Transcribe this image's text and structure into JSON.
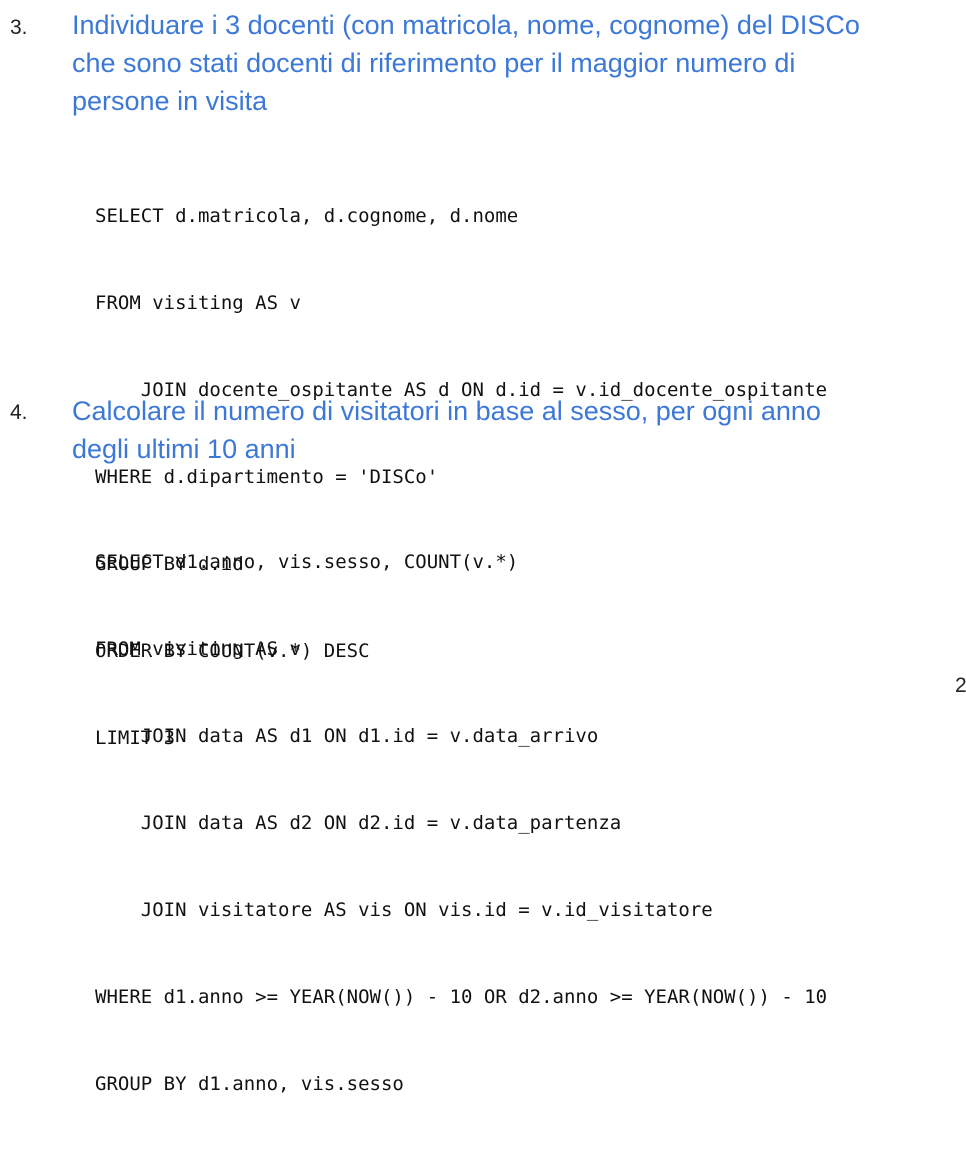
{
  "questions": [
    {
      "number": "3.",
      "title_lines": [
        "Individuare i 3 docenti (con matricola, nome, cognome) del DISCo",
        "che sono stati docenti di riferimento per il maggior numero di",
        "persone in visita"
      ],
      "sql_lines": [
        "SELECT d.matricola, d.cognome, d.nome",
        "FROM visiting AS v",
        "    JOIN docente_ospitante AS d ON d.id = v.id_docente_ospitante",
        "WHERE d.dipartimento = 'DISCo'",
        "GROUP BY d.id",
        "ORDER BY COUNT(v.*) DESC",
        "LIMIT 3"
      ]
    },
    {
      "number": "4.",
      "title_lines": [
        "Calcolare il numero di visitatori in base al sesso, per ogni anno",
        "degli ultimi 10 anni"
      ],
      "sql_lines": [
        "SELECT d1.anno, vis.sesso, COUNT(v.*)",
        "FROM visiting AS v",
        "    JOIN data AS d1 ON d1.id = v.data_arrivo",
        "    JOIN data AS d2 ON d2.id = v.data_partenza",
        "    JOIN visitatore AS vis ON vis.id = v.id_visitatore",
        "WHERE d1.anno >= YEAR(NOW()) - 10 OR d2.anno >= YEAR(NOW()) - 10",
        "GROUP BY d1.anno, vis.sesso"
      ]
    }
  ],
  "page_number": "2",
  "colors": {
    "heading": "#3c78d8",
    "text": "#111111"
  }
}
